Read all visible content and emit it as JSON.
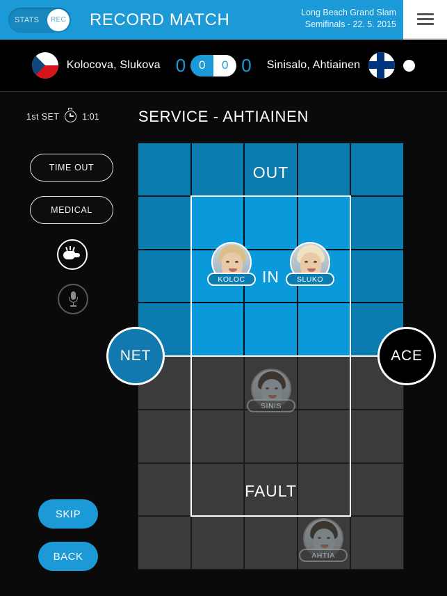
{
  "header": {
    "toggle": {
      "stats_label": "STATS",
      "rec_label": "REC",
      "active": "REC"
    },
    "title": "RECORD MATCH",
    "tournament": "Long Beach Grand Slam",
    "stage": "Semifinals - 22. 5. 2015",
    "menu_icon": "hamburger-menu-icon"
  },
  "scoreboard": {
    "home": {
      "name": "Kolocova, Slukova",
      "flag": "czech-republic-flag",
      "sets": "0",
      "points": "0",
      "serving": false
    },
    "away": {
      "name": "Sinisalo, Ahtiainen",
      "flag": "finland-flag",
      "sets": "0",
      "points": "0",
      "serving": true
    }
  },
  "setinfo": {
    "set_label": "1st  SET",
    "timer_icon": "stopwatch-icon",
    "timer": "1:01"
  },
  "service": {
    "title": "SERVICE - AHTIAINEN"
  },
  "court": {
    "zones": {
      "out": "OUT",
      "in": "IN",
      "fault": "FAULT"
    },
    "net_button": "NET",
    "ace_button": "ACE",
    "players": [
      {
        "badge": "KOLOC",
        "side": "near",
        "active": true
      },
      {
        "badge": "SLUKO",
        "side": "near",
        "active": true
      },
      {
        "badge": "SINIS",
        "side": "far",
        "active": false
      },
      {
        "badge": "AHTIA",
        "side": "far",
        "active": false
      }
    ]
  },
  "controls": {
    "time_out": "TIME OUT",
    "medical": "MEDICAL",
    "whistle_icon": "whistle-icon",
    "mic_icon": "microphone-icon",
    "skip": "SKIP",
    "back": "BACK"
  },
  "colors": {
    "brand_blue": "#1b9ad7",
    "court_out_blue": "#0a7cb0",
    "court_in_blue": "#0a9adb",
    "court_far_gray": "#3b3b3b",
    "background": "#0a0a0a"
  }
}
